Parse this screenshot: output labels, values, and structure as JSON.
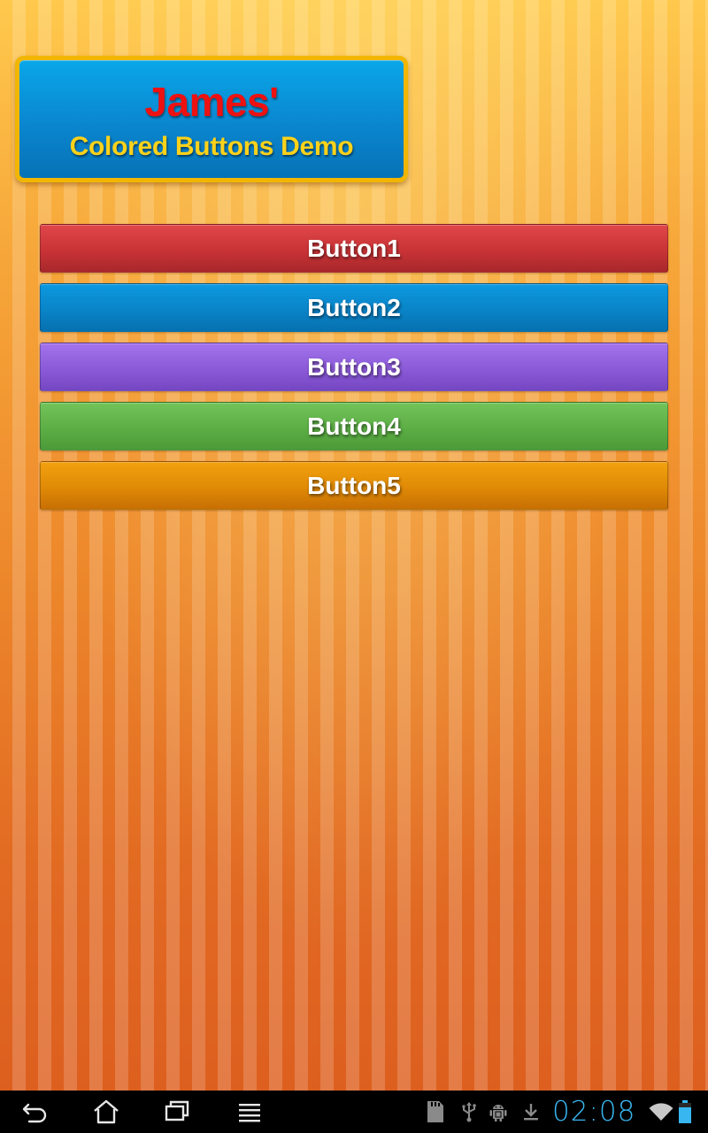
{
  "header": {
    "title": "James'",
    "subtitle": "Colored Buttons Demo"
  },
  "buttons": [
    {
      "label": "Button1",
      "color": "#c93336"
    },
    {
      "label": "Button2",
      "color": "#0a84c8"
    },
    {
      "label": "Button3",
      "color": "#8b5ad8"
    },
    {
      "label": "Button4",
      "color": "#5cae45"
    },
    {
      "label": "Button5",
      "color": "#e08a06"
    }
  ],
  "navigation": {
    "items": [
      "back-icon",
      "home-icon",
      "recent-apps-icon",
      "menu-icon"
    ]
  },
  "status_bar": {
    "time": "02:08",
    "icons": [
      "sd-card-icon",
      "usb-icon",
      "android-debug-icon",
      "download-icon",
      "wifi-icon",
      "battery-icon"
    ],
    "clock_color": "#38b6f0"
  },
  "colors": {
    "background_top": "#ffc94d",
    "background_bottom": "#dd5f1f",
    "title_card": "#0a86cf",
    "title_border": "#f2b600",
    "title_text": "#ee1111",
    "subtitle_text": "#ffd21a"
  }
}
